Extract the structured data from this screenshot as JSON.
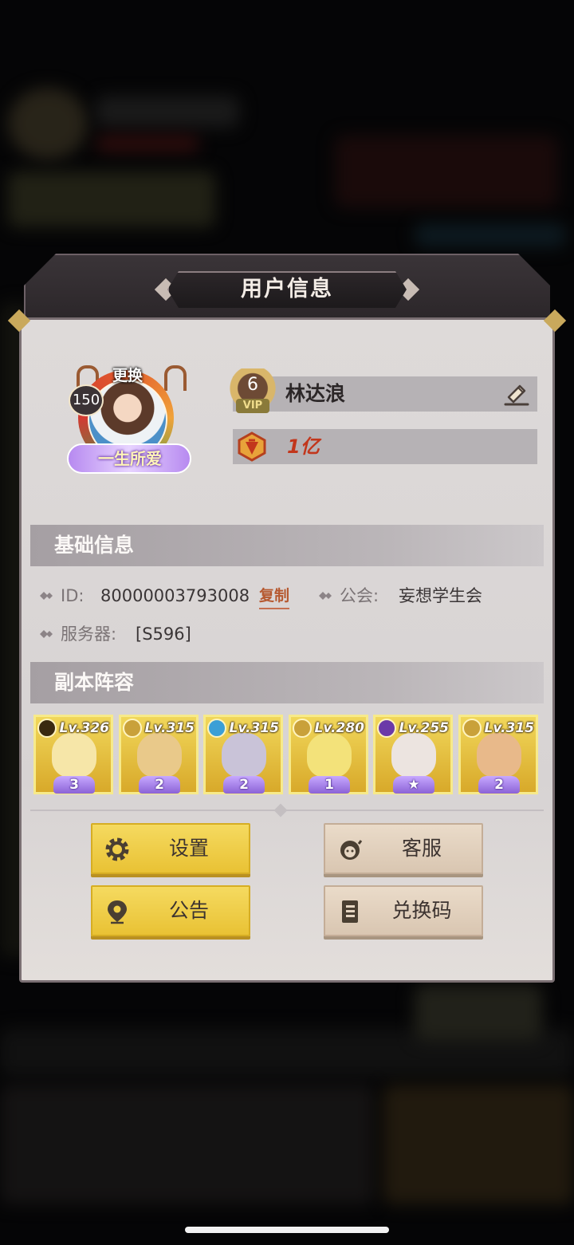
{
  "dialog": {
    "title": "用户信息"
  },
  "profile": {
    "avatar_change_label": "更换",
    "level": "150",
    "title_badge": "一生所爱",
    "vip_level": "6",
    "vip_label": "VIP",
    "username": "林达浪",
    "power": "1亿"
  },
  "basic_info": {
    "section_title": "基础信息",
    "id_label": "ID:",
    "id_value": "80000003793008",
    "copy_label": "复制",
    "guild_label": "公会:",
    "guild_value": "妄想学生会",
    "server_label": "服务器:",
    "server_value": "[S596]"
  },
  "lineup": {
    "section_title": "副本阵容",
    "heroes": [
      {
        "level": "Lv.326",
        "stars": "3",
        "element_color": "#3a2a10",
        "art_color": "#f6e6a8"
      },
      {
        "level": "Lv.315",
        "stars": "2",
        "element_color": "#c9a13a",
        "art_color": "#e9c98a"
      },
      {
        "level": "Lv.315",
        "stars": "2",
        "element_color": "#3b9fd6",
        "art_color": "#c9c3d8"
      },
      {
        "level": "Lv.280",
        "stars": "1",
        "element_color": "#c9a13a",
        "art_color": "#f3e27a"
      },
      {
        "level": "Lv.255",
        "stars": "★",
        "element_color": "#6b3aa8",
        "art_color": "#ece4e0"
      },
      {
        "level": "Lv.315",
        "stars": "2",
        "element_color": "#c9a13a",
        "art_color": "#e8b98a"
      }
    ]
  },
  "buttons": {
    "settings": "设置",
    "support": "客服",
    "announcement": "公告",
    "redeem_code": "兑换码"
  },
  "colors": {
    "accent_yellow": "#f0cf47",
    "accent_beige": "#e0cfbc",
    "power_red": "#c2361c",
    "panel_bg": "#dcd8d8"
  }
}
